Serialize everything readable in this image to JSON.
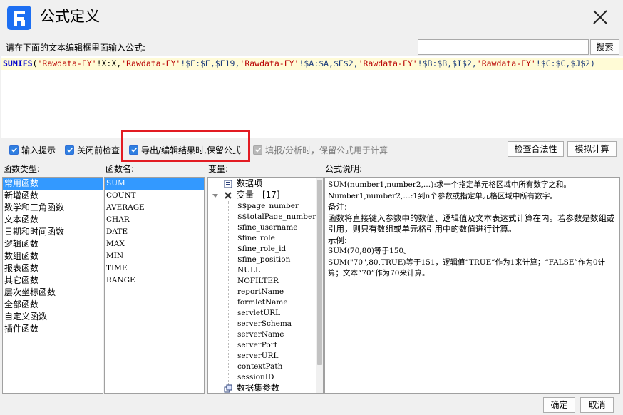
{
  "window": {
    "title": "公式定义",
    "logo_icon": "app-logo-icon",
    "close_icon": "close-icon"
  },
  "prompt": "请在下面的文本编辑框里面输入公式:",
  "search": {
    "value": "",
    "button": "搜索"
  },
  "formula": {
    "fn": "SUMIFS",
    "tokens": [
      {
        "t": "(",
        "c": "pun"
      },
      {
        "t": "'Rawdata-FY'",
        "c": "str"
      },
      {
        "t": "!X:X,",
        "c": "pun"
      },
      {
        "t": "'Rawdata-FY'",
        "c": "str"
      },
      {
        "t": "!$E:$E,$F19,",
        "c": "ref"
      },
      {
        "t": "'Rawdata-FY'",
        "c": "str"
      },
      {
        "t": "!$A:$A,$E$2,",
        "c": "ref"
      },
      {
        "t": "'Rawdata-FY'",
        "c": "str"
      },
      {
        "t": "!$B:$B,$I$2,",
        "c": "ref"
      },
      {
        "t": "'Rawdata-FY'",
        "c": "str"
      },
      {
        "t": "!$C:$C,$J$2)",
        "c": "ref"
      }
    ]
  },
  "options": {
    "hint": {
      "label": "输入提示",
      "checked": true
    },
    "check_before_close": {
      "label": "关闭前检查",
      "checked": true
    },
    "keep_formula_export": {
      "label": "导出/编辑结果时,保留公式",
      "checked": true
    },
    "keep_formula_fill": {
      "label": "填报/分析时，保留公式用于计算",
      "checked": true,
      "disabled": true
    }
  },
  "buttons": {
    "check": "检查合法性",
    "simulate": "模拟计算",
    "ok": "确定",
    "cancel": "取消"
  },
  "sections": {
    "type": "函数类型:",
    "fname": "函数名:",
    "var": "变量:",
    "desc": "公式说明:"
  },
  "function_types": [
    "常用函数",
    "新增函数",
    "数学和三角函数",
    "文本函数",
    "日期和时间函数",
    "逻辑函数",
    "数组函数",
    "报表函数",
    "其它函数",
    "层次坐标函数",
    "全部函数",
    "自定义函数",
    "插件函数"
  ],
  "function_names": [
    "SUM",
    "COUNT",
    "AVERAGE",
    "CHAR",
    "DATE",
    "MAX",
    "MIN",
    "TIME",
    "RANGE"
  ],
  "variables": {
    "data_item": "数据项",
    "var_root": "变量 - [17]",
    "items": [
      "$$page_number",
      "$$totalPage_number",
      "$fine_username",
      "$fine_role",
      "$fine_role_id",
      "$fine_position",
      "NULL",
      "NOFILTER",
      "reportName",
      "formletName",
      "servletURL",
      "serverSchema",
      "serverName",
      "serverPort",
      "serverURL",
      "contextPath",
      "sessionID"
    ],
    "dataset_params": "数据集参数"
  },
  "description": [
    "SUM(number1,number2,…):求一个指定单元格区域中所有数字之和。",
    "Number1,number2,…:1到n个参数或指定单元格区域中所有数字。",
    "备注:",
    "函数将直接键入参数中的数值、逻辑值及文本表达式计算在内。若参数是数组或引用，则只有数组或单元格引用中的数值进行计算。",
    "示例:",
    "SUM(70,80)等于150。",
    "SUM(\"70\",80,TRUE)等于151，逻辑值“TRUE”作为1来计算；“FALSE”作为0计算；文本“70”作为70来计算。"
  ]
}
